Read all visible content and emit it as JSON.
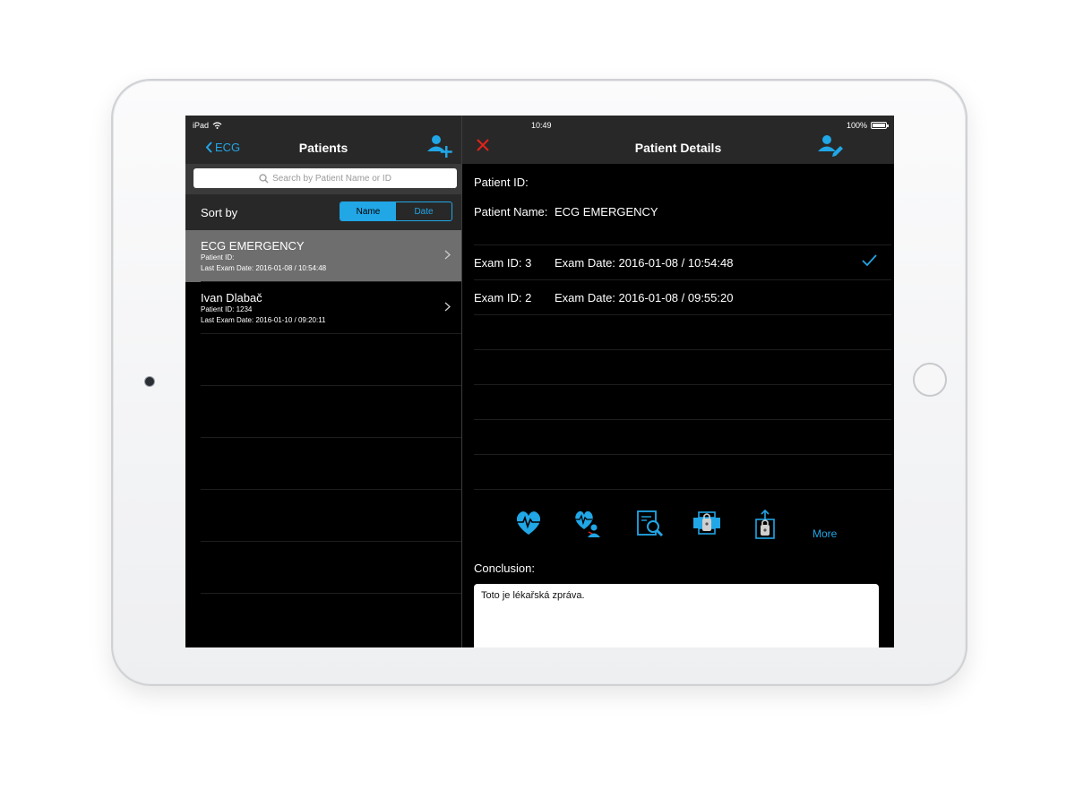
{
  "status_bar": {
    "device": "iPad",
    "time": "10:49",
    "battery": "100%"
  },
  "colors": {
    "accent": "#21a6e6",
    "close": "#e2231a",
    "selected_row": "#6e6e6e",
    "nav_bg": "#282828"
  },
  "patients_panel": {
    "back_label": "ECG",
    "title": "Patients",
    "search_placeholder": "Search by Patient Name or ID",
    "sort_label": "Sort by",
    "sort_options": [
      "Name",
      "Date"
    ],
    "sort_selected": "Name",
    "patients": [
      {
        "name": "ECG EMERGENCY",
        "patient_id": "Patient ID:",
        "last_exam": "Last Exam Date: 2016-01-08 / 10:54:48",
        "selected": true
      },
      {
        "name": "Ivan Dlabač",
        "patient_id": "Patient ID: 1234",
        "last_exam": "Last Exam Date: 2016-01-10 / 09:20:11",
        "selected": false
      }
    ]
  },
  "details_panel": {
    "title": "Patient Details",
    "patient_id_label": "Patient ID:",
    "patient_name_label": "Patient Name:",
    "patient_name_value": "ECG EMERGENCY",
    "exams": [
      {
        "id": "Exam ID: 3",
        "date": "Exam Date: 2016-01-08 / 10:54:48",
        "checked": true
      },
      {
        "id": "Exam ID: 2",
        "date": "Exam Date: 2016-01-08 / 09:55:20",
        "checked": false
      }
    ],
    "toolbar_icons": [
      "heart-ecg-icon",
      "heart-doctor-icon",
      "magnify-document-icon",
      "lock-printer-icon",
      "lock-share-icon"
    ],
    "more_label": "More",
    "conclusion_label": "Conclusion:",
    "conclusion_text": "Toto je lékařská zpráva."
  }
}
